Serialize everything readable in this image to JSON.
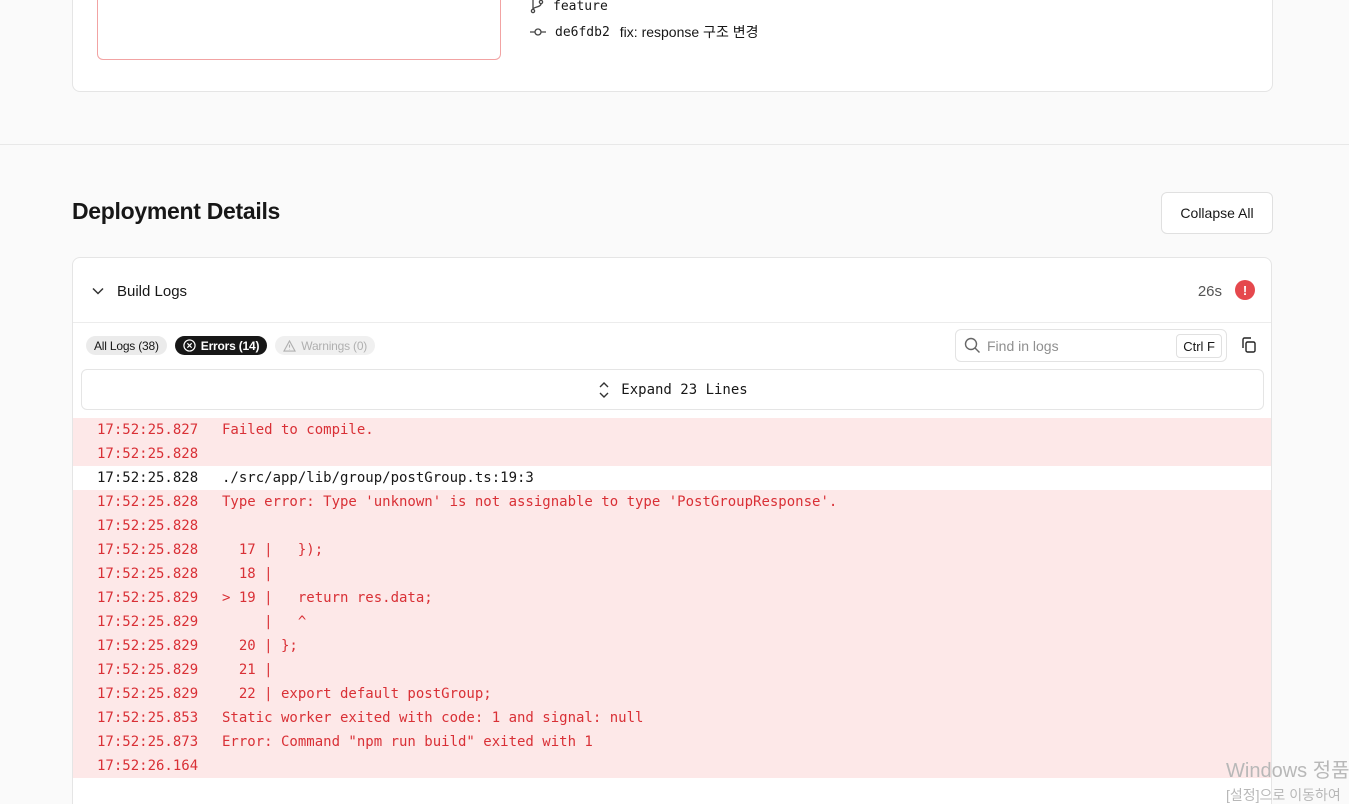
{
  "top": {
    "branch": "feature",
    "commit_hash": "de6fdb2",
    "commit_message": "fix: response 구조 변경"
  },
  "section": {
    "title": "Deployment Details",
    "collapse_label": "Collapse All"
  },
  "build_logs": {
    "title": "Build Logs",
    "duration": "26s",
    "status_icon": "error-exclamation-icon",
    "filters": {
      "all": "All Logs (38)",
      "errors": "Errors (14)",
      "warnings": "Warnings (0)"
    },
    "search_placeholder": "Find in logs",
    "shortcut": "Ctrl F",
    "expand_label": "Expand 23 Lines",
    "lines": [
      {
        "ts": "17:52:25.827",
        "msg": "Failed to compile.",
        "level": "error"
      },
      {
        "ts": "17:52:25.828",
        "msg": "",
        "level": "error"
      },
      {
        "ts": "17:52:25.828",
        "msg": "./src/app/lib/group/postGroup.ts:19:3",
        "level": "normal"
      },
      {
        "ts": "17:52:25.828",
        "msg": "Type error: Type 'unknown' is not assignable to type 'PostGroupResponse'.",
        "level": "error"
      },
      {
        "ts": "17:52:25.828",
        "msg": "",
        "level": "error"
      },
      {
        "ts": "17:52:25.828",
        "msg": "  17 |   });",
        "level": "error"
      },
      {
        "ts": "17:52:25.828",
        "msg": "  18 |",
        "level": "error"
      },
      {
        "ts": "17:52:25.829",
        "msg": "> 19 |   return res.data;",
        "level": "error"
      },
      {
        "ts": "17:52:25.829",
        "msg": "     |   ^",
        "level": "error"
      },
      {
        "ts": "17:52:25.829",
        "msg": "  20 | };",
        "level": "error"
      },
      {
        "ts": "17:52:25.829",
        "msg": "  21 |",
        "level": "error"
      },
      {
        "ts": "17:52:25.829",
        "msg": "  22 | export default postGroup;",
        "level": "error"
      },
      {
        "ts": "17:52:25.853",
        "msg": "Static worker exited with code: 1 and signal: null",
        "level": "error"
      },
      {
        "ts": "17:52:25.873",
        "msg": "Error: Command \"npm run build\" exited with 1",
        "level": "error"
      },
      {
        "ts": "17:52:26.164",
        "msg": "",
        "level": "error"
      }
    ]
  },
  "watermark": {
    "line1": "Windows 정품",
    "line2": "[설정]으로 이동하여"
  },
  "colors": {
    "error_text": "#d93036",
    "error_bg": "#fde8e8",
    "error_badge": "#e5484d"
  }
}
